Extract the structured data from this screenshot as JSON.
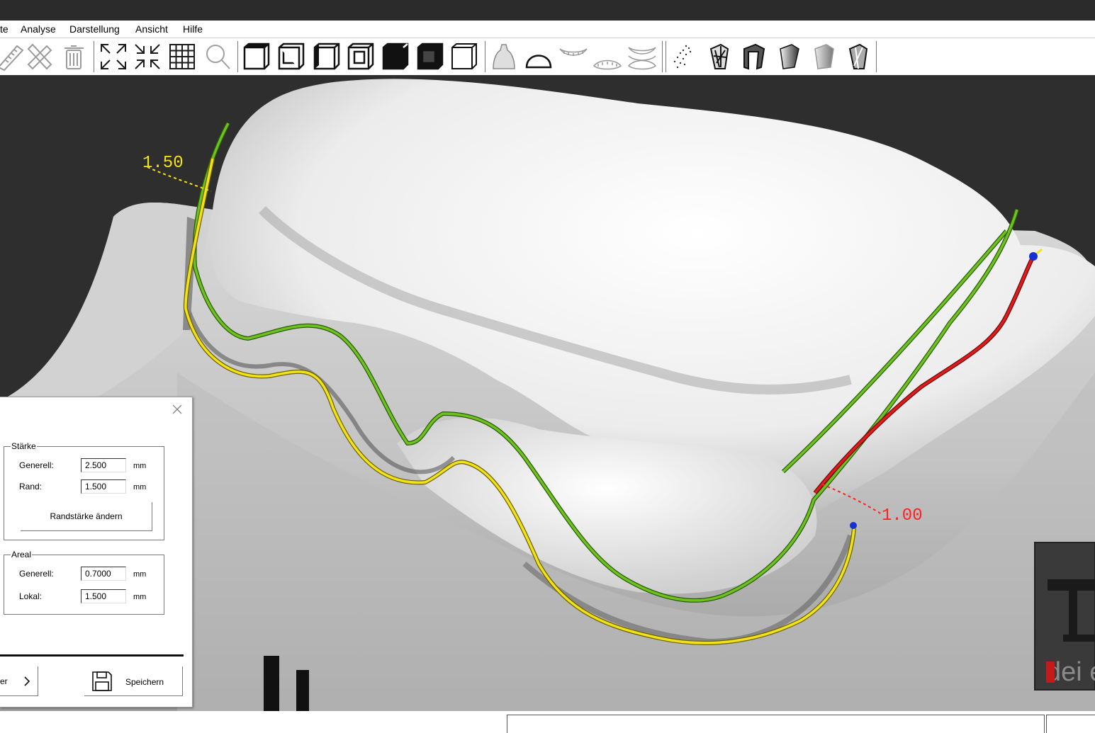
{
  "menu": [
    "te",
    "Analyse",
    "Darstellung",
    "Ansicht",
    "Hilfe"
  ],
  "toolbar": {
    "icons": [
      "ruler-icon",
      "measure-cross-icon",
      "trash-icon",
      "zoom-fit-icon",
      "zoom-in-icon",
      "grid-icon",
      "magnifier-icon",
      "view-front-icon",
      "view-top-icon",
      "view-left-icon",
      "view-right-icon",
      "view-back-icon",
      "view-bottom-icon",
      "view-iso-icon",
      "lower-jaw-icon",
      "upper-arch-icon",
      "upper-teeth-icon",
      "lower-teeth-icon",
      "both-jaws-icon",
      "point-cloud-icon",
      "crown-wireframe-icon",
      "crown-coping-icon",
      "crown-solid-icon",
      "crown-shaded-icon",
      "crown-mesh-icon"
    ]
  },
  "viewport": {
    "label_left": "1.50",
    "label_right": "1.00",
    "colors": {
      "margin_line": "#f2e21a",
      "inner_line": "#6cc21f",
      "distal_line": "#e11b1b",
      "label_left": "#f2e21a",
      "label_right": "#ff2020"
    }
  },
  "dialog": {
    "staerke": {
      "title": "Stärke",
      "generell_label": "Generell:",
      "generell_value": "2.500",
      "rand_label": "Rand:",
      "rand_value": "1.500",
      "unit": "mm",
      "button": "Randstärke ändern"
    },
    "areal": {
      "title": "Areal",
      "generell_label": "Generell:",
      "generell_value": "0.7000",
      "lokal_label": "Lokal:",
      "lokal_value": "1.500",
      "unit": "mm"
    },
    "next_label": "er",
    "save_label": "Speichern"
  },
  "logo_text": "dei e"
}
